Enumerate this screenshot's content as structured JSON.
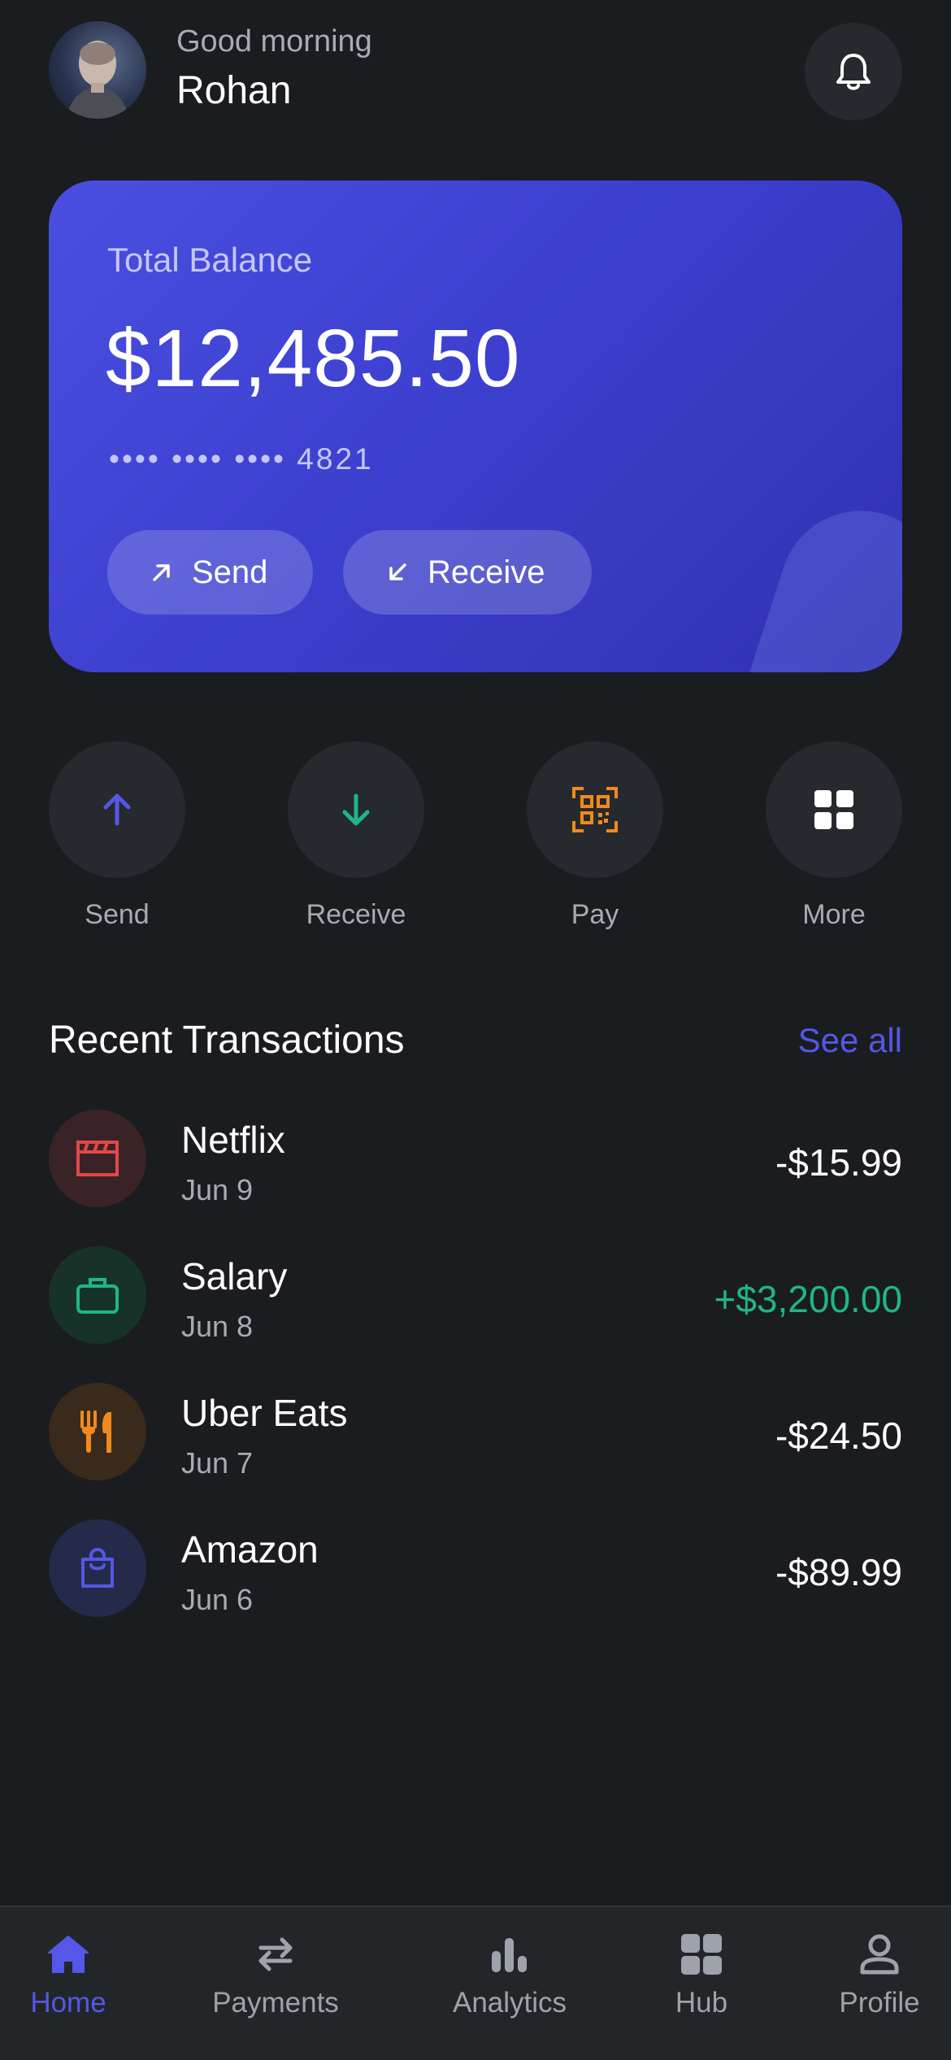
{
  "colors": {
    "background": "#1a1c1f",
    "card_start": "#4a4fe0",
    "card_end": "#3031b0",
    "accent": "#5457e8",
    "positive": "#1fb589",
    "orange": "#f08a1c",
    "red": "#e04848"
  },
  "header": {
    "greeting": "Good morning",
    "name": "Rohan",
    "avatar_icon": "user-photo",
    "bell_icon": "bell-icon"
  },
  "balance_card": {
    "label": "Total Balance",
    "amount": "$12,485.50",
    "card_number": "•••• •••• •••• 4821",
    "send_label": "Send",
    "receive_label": "Receive"
  },
  "quick_actions": [
    {
      "label": "Send",
      "icon": "arrow-up-icon"
    },
    {
      "label": "Receive",
      "icon": "arrow-down-icon"
    },
    {
      "label": "Pay",
      "icon": "qr-code-icon"
    },
    {
      "label": "More",
      "icon": "grid-icon"
    }
  ],
  "transactions_section": {
    "title": "Recent Transactions",
    "see_all": "See all"
  },
  "transactions": [
    {
      "name": "Netflix",
      "date": "Jun 9",
      "amount": "-$15.99",
      "icon": "clapperboard-icon"
    },
    {
      "name": "Salary",
      "date": "Jun 8",
      "amount": "+$3,200.00",
      "icon": "briefcase-icon"
    },
    {
      "name": "Uber Eats",
      "date": "Jun 7",
      "amount": "-$24.50",
      "icon": "utensils-icon"
    },
    {
      "name": "Amazon",
      "date": "Jun 6",
      "amount": "-$89.99",
      "icon": "shopping-bag-icon"
    }
  ],
  "tabbar": [
    {
      "label": "Home",
      "icon": "home-icon",
      "active": true
    },
    {
      "label": "Payments",
      "icon": "transfer-arrows-icon",
      "active": false
    },
    {
      "label": "Analytics",
      "icon": "bar-chart-icon",
      "active": false
    },
    {
      "label": "Hub",
      "icon": "grid-icon",
      "active": false
    },
    {
      "label": "Profile",
      "icon": "user-icon",
      "active": false
    }
  ]
}
